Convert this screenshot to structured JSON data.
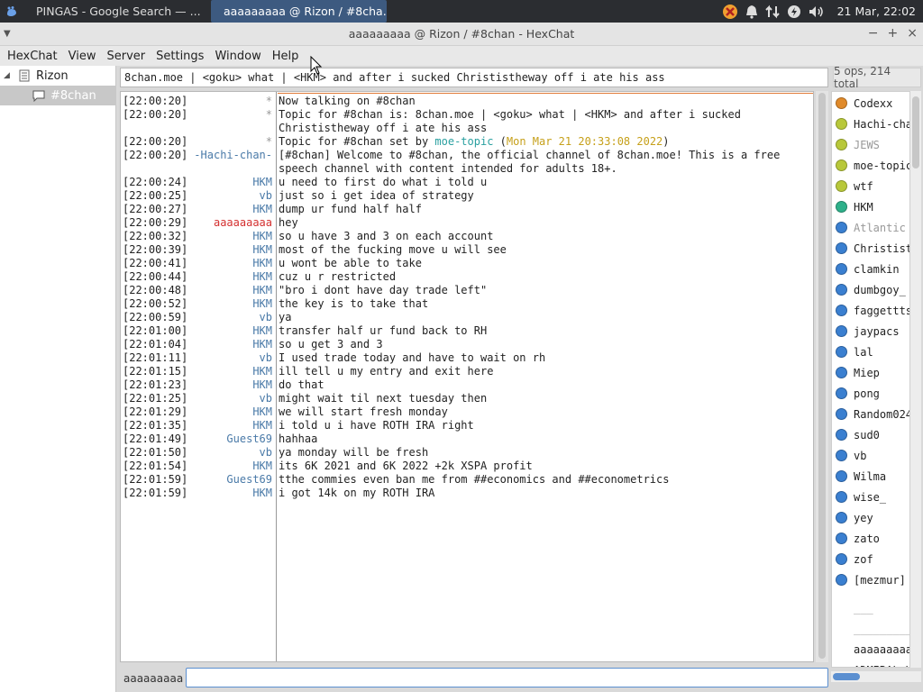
{
  "taskbar": {
    "tasks": [
      {
        "label": "PINGAS - Google Search — ..."
      },
      {
        "label": "aaaaaaaaa @ Rizon / #8cha..."
      }
    ],
    "clock": "21 Mar, 22:02"
  },
  "window": {
    "title": "aaaaaaaaa @ Rizon / #8chan - HexChat"
  },
  "menu": [
    "HexChat",
    "View",
    "Server",
    "Settings",
    "Window",
    "Help"
  ],
  "tree": {
    "server": "Rizon",
    "channel": "#8chan"
  },
  "topic": {
    "text": "8chan.moe | <goku> what | <HKM> and after i sucked Christistheway off i ate his ass"
  },
  "opcount": "5 ops, 214 total",
  "chat": {
    "lines": [
      {
        "ts": "[22:00:20]",
        "nick": "*",
        "nc": "c-star",
        "msg": "Now talking on #8chan"
      },
      {
        "ts": "[22:00:20]",
        "nick": "*",
        "nc": "c-star",
        "msg": "Topic for #8chan is: 8chan.moe | <goku> what | <HKM> and after i sucked\nChrististheway off i ate his ass",
        "rows": 2
      },
      {
        "ts": "[22:00:20]",
        "nick": "*",
        "nc": "c-star",
        "msg": "Topic for #8chan set by ",
        "extra": [
          {
            "t": "moe-topic",
            "c": "c-teal"
          },
          {
            "t": " (",
            "c": ""
          },
          {
            "t": "Mon Mar 21 20:33:08 2022",
            "c": "c-gold"
          },
          {
            "t": ")",
            "c": ""
          }
        ]
      },
      {
        "ts": "[22:00:20]",
        "nick": "-Hachi-chan-",
        "nc": "c-blue",
        "msg": "[#8chan] Welcome to #8chan, the official channel of 8chan.moe! This is a free\nspeech channel with content intended for adults 18+.",
        "rows": 2
      },
      {
        "ts": "[22:00:24]",
        "nick": "HKM",
        "nc": "c-blue",
        "msg": "u need to first do what i told u"
      },
      {
        "ts": "[22:00:25]",
        "nick": "vb",
        "nc": "c-blue",
        "msg": "just so i get idea of strategy"
      },
      {
        "ts": "[22:00:27]",
        "nick": "HKM",
        "nc": "c-blue",
        "msg": "dump ur fund half half"
      },
      {
        "ts": "[22:00:29]",
        "nick": "aaaaaaaaa",
        "nc": "c-red",
        "msg": "hey",
        "mc": "c-gray"
      },
      {
        "ts": "[22:00:32]",
        "nick": "HKM",
        "nc": "c-blue",
        "msg": "so u have 3 and 3 on each account"
      },
      {
        "ts": "[22:00:39]",
        "nick": "HKM",
        "nc": "c-blue",
        "msg": "most of the fucking move u will see"
      },
      {
        "ts": "[22:00:41]",
        "nick": "HKM",
        "nc": "c-blue",
        "msg": "u wont be able to take"
      },
      {
        "ts": "[22:00:44]",
        "nick": "HKM",
        "nc": "c-blue",
        "msg": "cuz u r restricted"
      },
      {
        "ts": "[22:00:48]",
        "nick": "HKM",
        "nc": "c-blue",
        "msg": "\"bro i dont have day trade left\""
      },
      {
        "ts": "[22:00:52]",
        "nick": "HKM",
        "nc": "c-blue",
        "msg": "the key is to take that"
      },
      {
        "ts": "[22:00:59]",
        "nick": "vb",
        "nc": "c-blue",
        "msg": "ya"
      },
      {
        "ts": "[22:01:00]",
        "nick": "HKM",
        "nc": "c-blue",
        "msg": "transfer half ur fund back to RH"
      },
      {
        "ts": "[22:01:04]",
        "nick": "HKM",
        "nc": "c-blue",
        "msg": "so u get 3 and 3"
      },
      {
        "ts": "[22:01:11]",
        "nick": "vb",
        "nc": "c-blue",
        "msg": "I used trade today and have to wait on rh"
      },
      {
        "ts": "[22:01:15]",
        "nick": "HKM",
        "nc": "c-blue",
        "msg": "ill tell u my entry and exit here"
      },
      {
        "ts": "[22:01:23]",
        "nick": "HKM",
        "nc": "c-blue",
        "msg": "do that"
      },
      {
        "ts": "[22:01:25]",
        "nick": "vb",
        "nc": "c-blue",
        "msg": "might wait til next tuesday then"
      },
      {
        "ts": "[22:01:29]",
        "nick": "HKM",
        "nc": "c-blue",
        "msg": "we will start fresh monday"
      },
      {
        "ts": "[22:01:35]",
        "nick": "HKM",
        "nc": "c-blue",
        "msg": "i told u i have ROTH IRA right"
      },
      {
        "ts": "[22:01:49]",
        "nick": "Guest69",
        "nc": "c-blue",
        "msg": "hahhaa"
      },
      {
        "ts": "[22:01:50]",
        "nick": "vb",
        "nc": "c-blue",
        "msg": "ya monday will be fresh"
      },
      {
        "ts": "[22:01:54]",
        "nick": "HKM",
        "nc": "c-blue",
        "msg": "its 6K 2021 and 6K 2022 +2k XSPA profit"
      },
      {
        "ts": "[22:01:59]",
        "nick": "Guest69",
        "nc": "c-blue",
        "msg": "tthe commies even ban me from ##economics and ##econometrics"
      },
      {
        "ts": "[22:01:59]",
        "nick": "HKM",
        "nc": "c-blue",
        "msg": "i got 14k on my ROTH IRA"
      }
    ]
  },
  "users": [
    {
      "name": "Codexx",
      "color": "#e08a2a"
    },
    {
      "name": "Hachi-chan",
      "color": "#b8c83a"
    },
    {
      "name": "JEWS",
      "color": "#b8c83a",
      "away": true
    },
    {
      "name": "moe-topic",
      "color": "#b8c83a"
    },
    {
      "name": "wtf",
      "color": "#b8c83a"
    },
    {
      "name": "HKM",
      "color": "#2eb08a"
    },
    {
      "name": "Atlantic",
      "color": "#3a7fd0",
      "away": true
    },
    {
      "name": "Christist",
      "color": "#3a7fd0"
    },
    {
      "name": "clamkin",
      "color": "#3a7fd0"
    },
    {
      "name": "dumbgoy_",
      "color": "#3a7fd0"
    },
    {
      "name": "faggettts",
      "color": "#3a7fd0"
    },
    {
      "name": "jaypacs",
      "color": "#3a7fd0"
    },
    {
      "name": "lal",
      "color": "#3a7fd0"
    },
    {
      "name": "Miep",
      "color": "#3a7fd0"
    },
    {
      "name": "pong",
      "color": "#3a7fd0"
    },
    {
      "name": "Random024",
      "color": "#3a7fd0"
    },
    {
      "name": "sud0",
      "color": "#3a7fd0"
    },
    {
      "name": "vb",
      "color": "#3a7fd0"
    },
    {
      "name": "Wilma",
      "color": "#3a7fd0"
    },
    {
      "name": "wise_",
      "color": "#3a7fd0"
    },
    {
      "name": "yey",
      "color": "#3a7fd0"
    },
    {
      "name": "zato",
      "color": "#3a7fd0"
    },
    {
      "name": "zof",
      "color": "#3a7fd0"
    },
    {
      "name": "[mezmur]",
      "color": "#3a7fd0"
    },
    {
      "name": "___",
      "color": "",
      "away": true
    },
    {
      "name": "___________",
      "color": "",
      "away": true
    },
    {
      "name": "aaaaaaaaa",
      "color": ""
    },
    {
      "name": "ADMIRAL_H",
      "color": ""
    }
  ],
  "input": {
    "nick": "aaaaaaaaa",
    "value": ""
  }
}
